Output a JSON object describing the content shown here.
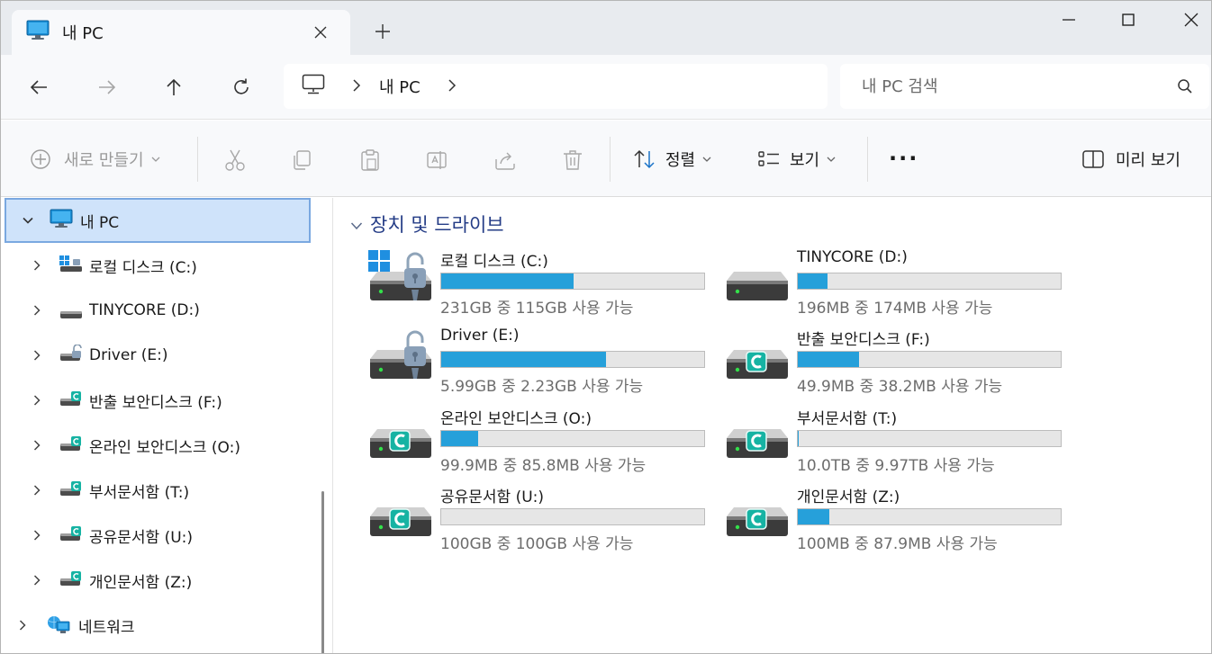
{
  "window": {
    "tab_title": "내 PC"
  },
  "address": {
    "breadcrumb_label": "내 PC",
    "search_placeholder": "내 PC 검색"
  },
  "toolbar": {
    "new_label": "새로 만들기",
    "sort_label": "정렬",
    "view_label": "보기",
    "more_label": "···",
    "preview_label": "미리 보기"
  },
  "sidebar": {
    "items": [
      {
        "label": "내 PC",
        "icon": "monitor-icon",
        "level": 0,
        "selected": true,
        "expanded": true
      },
      {
        "label": "로컬 디스크 (C:)",
        "icon": "windows-drive-icon",
        "level": 1
      },
      {
        "label": "TINYCORE (D:)",
        "icon": "drive-icon",
        "level": 1
      },
      {
        "label": "Driver (E:)",
        "icon": "locked-drive-icon",
        "level": 1
      },
      {
        "label": "반출 보안디스크 (F:)",
        "icon": "secure-drive-icon",
        "level": 1
      },
      {
        "label": "온라인 보안디스크 (O:)",
        "icon": "secure-drive-icon",
        "level": 1
      },
      {
        "label": "부서문서함 (T:)",
        "icon": "secure-drive-icon",
        "level": 1
      },
      {
        "label": "공유문서함 (U:)",
        "icon": "secure-drive-icon",
        "level": 1
      },
      {
        "label": "개인문서함 (Z:)",
        "icon": "secure-drive-icon",
        "level": 1
      },
      {
        "label": "네트워크",
        "icon": "network-icon",
        "level": 0
      }
    ]
  },
  "main": {
    "group_title": "장치 및 드라이브",
    "drives": [
      {
        "name": "로컬 디스크 (C:)",
        "info": "231GB 중 115GB 사용 가능",
        "used_fraction": 0.502,
        "icon": "windows-locked-drive-icon"
      },
      {
        "name": "TINYCORE (D:)",
        "info": "196MB 중 174MB 사용 가능",
        "used_fraction": 0.112,
        "icon": "drive-icon"
      },
      {
        "name": "Driver (E:)",
        "info": "5.99GB 중 2.23GB 사용 가능",
        "used_fraction": 0.628,
        "icon": "locked-drive-icon"
      },
      {
        "name": "반출 보안디스크 (F:)",
        "info": "49.9MB 중 38.2MB 사용 가능",
        "used_fraction": 0.234,
        "icon": "secure-drive-icon"
      },
      {
        "name": "온라인 보안디스크 (O:)",
        "info": "99.9MB 중 85.8MB 사용 가능",
        "used_fraction": 0.141,
        "icon": "secure-drive-icon"
      },
      {
        "name": "부서문서함 (T:)",
        "info": "10.0TB 중 9.97TB 사용 가능",
        "used_fraction": 0.003,
        "icon": "secure-drive-icon"
      },
      {
        "name": "공유문서함 (U:)",
        "info": "100GB 중 100GB 사용 가능",
        "used_fraction": 0.0,
        "icon": "secure-drive-icon"
      },
      {
        "name": "개인문서함 (Z:)",
        "info": "100MB 중 87.9MB 사용 가능",
        "used_fraction": 0.121,
        "icon": "secure-drive-icon"
      }
    ]
  },
  "colors": {
    "accent": "#26a0da",
    "selection": "#cfe3fa",
    "group_header": "#243c86"
  }
}
